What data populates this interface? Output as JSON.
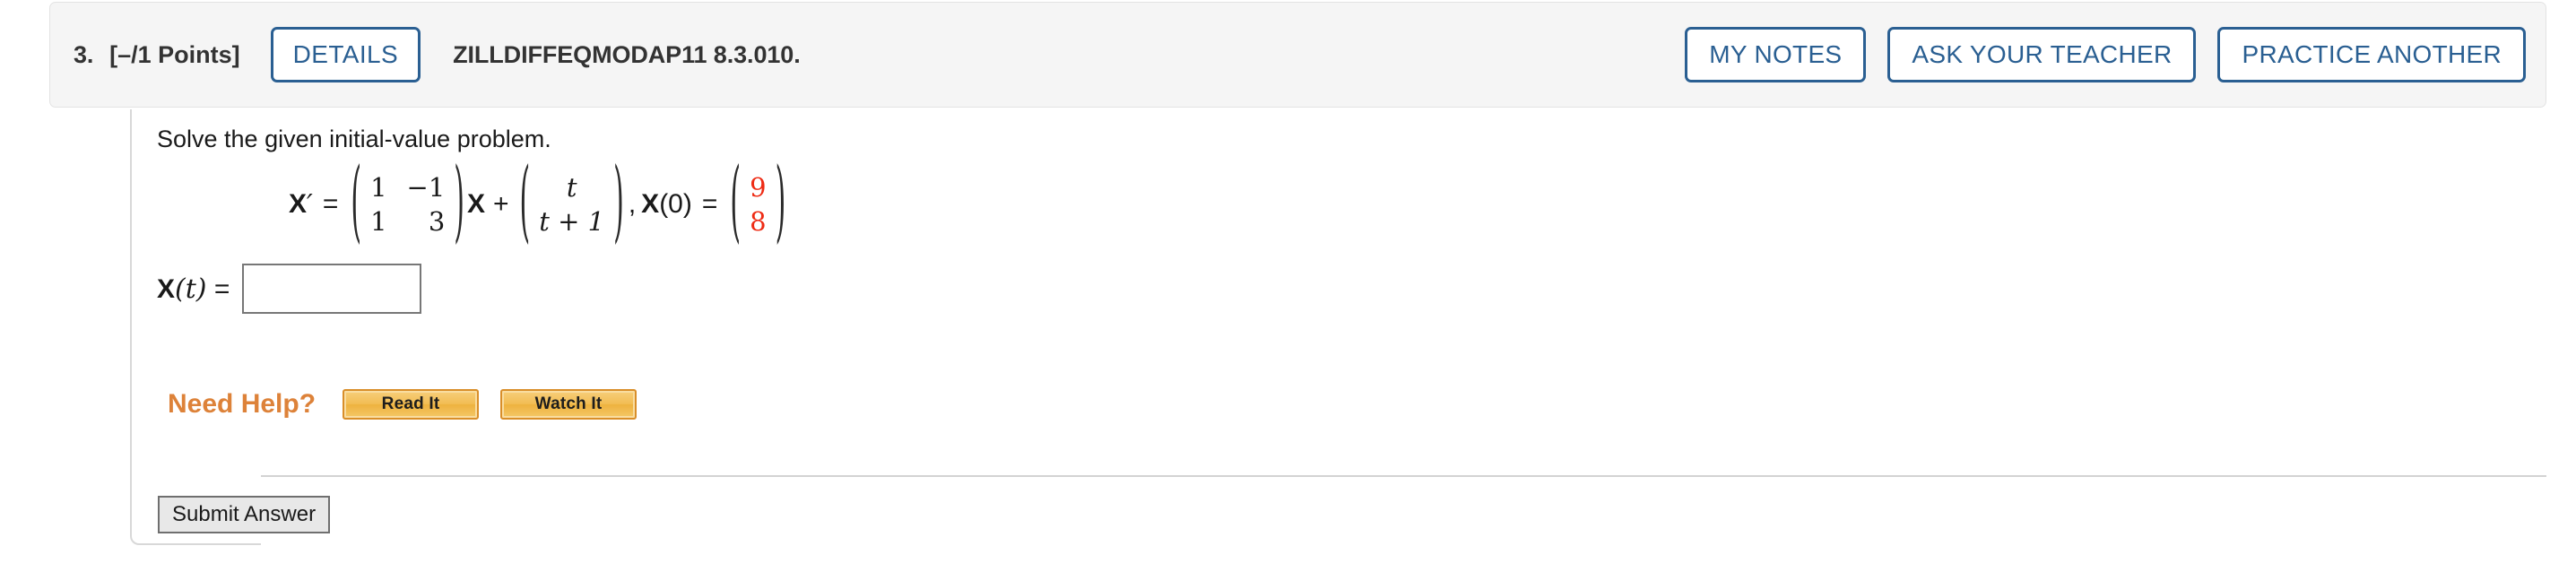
{
  "header": {
    "question_number": "3.",
    "points": "[–/1 Points]",
    "details_label": "DETAILS",
    "question_code": "ZILLDIFFEQMODAP11 8.3.010.",
    "actions": [
      {
        "label": "MY NOTES",
        "name": "my-notes-button"
      },
      {
        "label": "ASK YOUR TEACHER",
        "name": "ask-your-teacher-button"
      },
      {
        "label": "PRACTICE ANOTHER",
        "name": "practice-another-button"
      }
    ],
    "accent_color": "#2a5f92",
    "band_background": "#f5f5f5"
  },
  "body": {
    "prompt": "Solve the given initial-value problem.",
    "equation": {
      "lhs": "X",
      "prime": "′",
      "equals": "=",
      "coefficient_matrix": {
        "rows": [
          [
            "1",
            "−1"
          ],
          [
            "1",
            "3"
          ]
        ]
      },
      "times_vector": "X",
      "plus": "+",
      "forcing_vector": {
        "rows": [
          [
            "t"
          ],
          [
            "t + 1"
          ]
        ]
      },
      "comma": ",",
      "initial_label": "X",
      "initial_arg": "(0)",
      "initial_equals": "=",
      "initial_vector": {
        "rows": [
          [
            "9"
          ],
          [
            "8"
          ]
        ],
        "color": "#ee2b14"
      }
    },
    "answer": {
      "label_x": "X",
      "label_t": "(t)",
      "label_equals": "=",
      "value": "",
      "placeholder": ""
    },
    "help": {
      "label": "Need Help?",
      "label_color": "#dd8239",
      "buttons": [
        {
          "label": "Read It",
          "name": "read-it-button"
        },
        {
          "label": "Watch It",
          "name": "watch-it-button"
        }
      ]
    },
    "submit_label": "Submit Answer"
  }
}
